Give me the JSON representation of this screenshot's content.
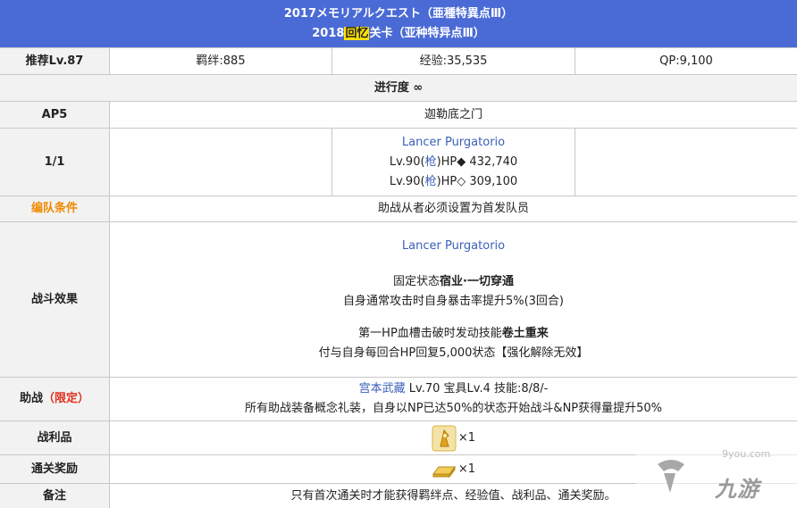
{
  "header": {
    "title_jp": "2017メモリアルクエスト（亜種特異点Ⅲ）",
    "title_cn_prefix": "2018",
    "title_cn_hl": "回忆",
    "title_cn_suffix": "关卡（亚种特异点Ⅲ）"
  },
  "rec": {
    "label": "推荐Lv.87",
    "bond": "羁绊:885",
    "exp": "经验:35,535",
    "qp": "QP:9,100"
  },
  "progress": {
    "label": "进行度 ∞"
  },
  "ap": {
    "label": "AP5",
    "name": "迦勒底之门"
  },
  "wave": {
    "label": "1/1",
    "enemy": "Lancer Purgatorio",
    "lv1_pre": "Lv.90(",
    "class1": "枪",
    "lv1_post": ")HP◆ 432,740",
    "lv2_pre": "Lv.90(",
    "class2": "枪",
    "lv2_post": ")HP◇ 309,100"
  },
  "formation": {
    "label": "编队条件",
    "text": "助战从者必须设置为首发队员"
  },
  "battle": {
    "label": "战斗效果",
    "enemy": "Lancer Purgatorio",
    "l1_pre": "固定状态",
    "l1_bold": "宿业·一切穿通",
    "l2": "自身通常攻击时自身暴击率提升5%(3回合)",
    "l3_pre": "第一HP血槽击破时发动技能",
    "l3_bold": "卷土重来",
    "l4": "付与自身每回合HP回复5,000状态【强化解除无效】"
  },
  "support": {
    "label": "助战",
    "label_tag": "（限定）",
    "servant": "宫本武藏",
    "servant_info": " Lv.70 宝具Lv.4 技能:8/8/-",
    "desc": "所有助战装备概念礼装，自身以NP已达50%的状态开始战斗&NP获得量提升50%"
  },
  "drops": {
    "label": "战利品",
    "count": "×1"
  },
  "reward": {
    "label": "通关奖励",
    "count": "×1"
  },
  "note": {
    "label": "备注",
    "text": "只有首次通关时才能获得羁绊点、经验值、战利品、通关奖励。"
  },
  "watermark": {
    "site": "9you.com",
    "logo": "九游"
  },
  "colors": {
    "header_bg": "#4a6bd6",
    "label_bg": "#f2f2f2",
    "link": "#3a5fb8",
    "orange": "#f08a00",
    "red": "#e0301e",
    "highlight": "#ffe100"
  }
}
